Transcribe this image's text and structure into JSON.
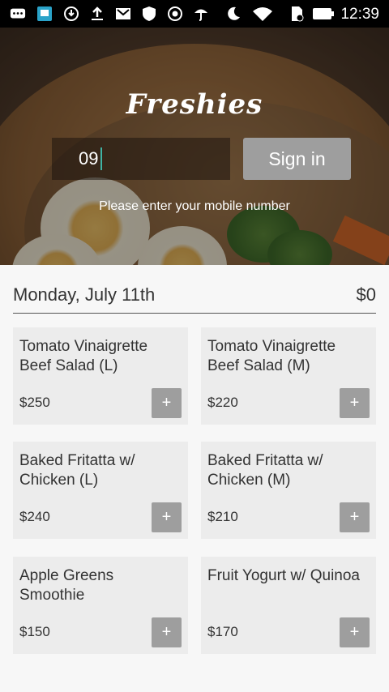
{
  "status_bar": {
    "time": "12:39",
    "icons": [
      "chat-icon",
      "app-icon",
      "sync-icon",
      "upload-icon",
      "mail-icon",
      "shield-icon",
      "record-icon",
      "umbrella-icon",
      "moon-icon",
      "wifi-icon",
      "sim-icon",
      "battery-icon"
    ]
  },
  "app": {
    "name": "Freshies"
  },
  "login": {
    "phone_value": "09",
    "sign_in_label": "Sign in",
    "hint": "Please enter your mobile number"
  },
  "menu": {
    "date": "Monday, July 11th",
    "total": "$0",
    "items": [
      {
        "name": "Tomato Vinaigrette Beef Salad (L)",
        "price": "$250",
        "add_label": "+"
      },
      {
        "name": "Tomato Vinaigrette Beef Salad (M)",
        "price": "$220",
        "add_label": "+"
      },
      {
        "name": "Baked Fritatta w/ Chicken (L)",
        "price": "$240",
        "add_label": "+"
      },
      {
        "name": "Baked Fritatta w/ Chicken (M)",
        "price": "$210",
        "add_label": "+"
      },
      {
        "name": "Apple Greens Smoothie",
        "price": "$150",
        "add_label": "+"
      },
      {
        "name": "Fruit Yogurt w/ Quinoa",
        "price": "$170",
        "add_label": "+"
      }
    ]
  },
  "colors": {
    "button_gray": "#9e9e9e",
    "caret": "#3fb3a4",
    "card_bg": "#ececec"
  }
}
